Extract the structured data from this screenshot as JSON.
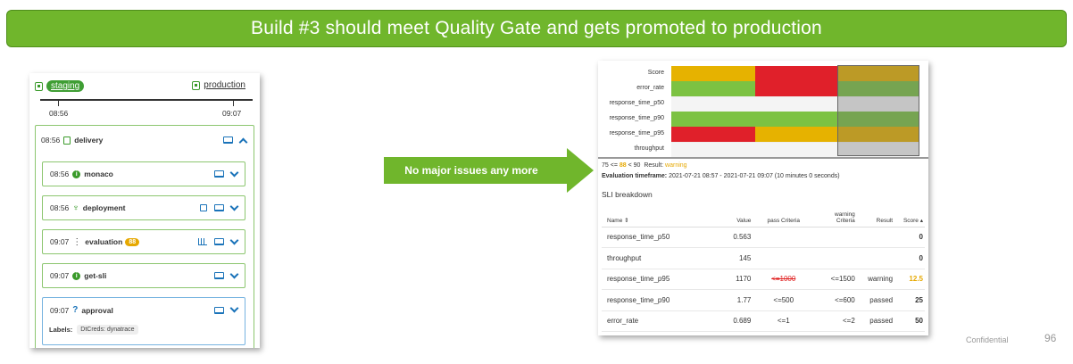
{
  "banner": "Build #3 should meet Quality Gate and gets promoted to production",
  "colors": {
    "green_accent": "#70b62c",
    "fail": "#e0202a",
    "warn": "#e6b200",
    "pass": "#7cc242",
    "neutral": "#f4f4f4",
    "badge": "#e6a800"
  },
  "stages": {
    "staging": "staging",
    "production": "production",
    "staging_time": "08:56",
    "production_time": "09:07"
  },
  "delivery": {
    "time": "08:56",
    "name": "delivery"
  },
  "tasks": [
    {
      "time": "08:56",
      "name": "monaco",
      "icon": "info-icon"
    },
    {
      "time": "08:56",
      "name": "deployment",
      "icon": "deploy-icon"
    },
    {
      "time": "09:07",
      "name": "evaluation",
      "icon": "traffic-light-icon",
      "badge": "88"
    },
    {
      "time": "09:07",
      "name": "get-sli",
      "icon": "info-icon"
    },
    {
      "time": "09:07",
      "name": "approval",
      "icon": "question-icon"
    }
  ],
  "approval_labels": {
    "label": "Labels:",
    "chip": "DtCreds: dynatrace"
  },
  "arrow_text": "No major issues any more",
  "heatmap": {
    "rows": [
      "Score",
      "error_rate",
      "response_time_p50",
      "response_time_p90",
      "response_time_p95",
      "throughput"
    ]
  },
  "summary": {
    "prefix": "75 <= ",
    "score": "88",
    "middle": " < 90",
    "result_label": "Result: ",
    "result": "warning"
  },
  "timeframe": {
    "label": "Evaluation timeframe:",
    "value": " 2021-07-21 08:57 - 2021-07-21 09:07 (10 minutes 0 seconds)"
  },
  "sli_title": "SLI breakdown",
  "table": {
    "headers": {
      "name": "Name ⇕",
      "value": "Value",
      "pass": "pass Criteria",
      "warning_l1": "warning",
      "warning_l2": "Criteria",
      "result": "Result",
      "score": "Score ▴"
    },
    "rows": [
      {
        "name": "response_time_p50",
        "value": "0.563",
        "pass": "",
        "warning": "",
        "result": "",
        "score": "0"
      },
      {
        "name": "throughput",
        "value": "145",
        "pass": "",
        "warning": "",
        "result": "",
        "score": "0"
      },
      {
        "name": "response_time_p95",
        "value": "1170",
        "pass": "<=1000",
        "warning": "<=1500",
        "result": "warning",
        "score": "12.5"
      },
      {
        "name": "response_time_p90",
        "value": "1.77",
        "pass": "<=500",
        "warning": "<=600",
        "result": "passed",
        "score": "25"
      },
      {
        "name": "error_rate",
        "value": "0.689",
        "pass": "<=1",
        "warning": "<=2",
        "result": "passed",
        "score": "50"
      }
    ]
  },
  "footer": {
    "confidential": "Confidential",
    "page": "96"
  }
}
